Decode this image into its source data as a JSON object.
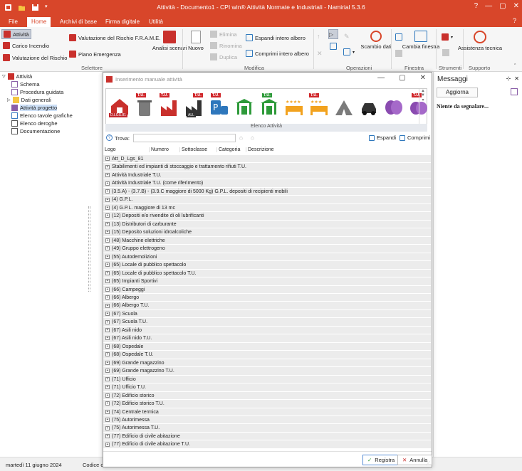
{
  "app": {
    "title": "Attività - Documento1 - CPI win® Attività Normate e Industriali - Namirial 5.3.6",
    "window_controls": [
      "?",
      "—",
      "▢",
      "✕"
    ]
  },
  "ribbon_tabs": [
    "File",
    "Home",
    "Archivi di base",
    "Firma digitale",
    "Utilità"
  ],
  "ribbon": {
    "selettore": {
      "attivita": "Attività",
      "carico_incendio": "Carico Incendio",
      "valutazione_rischio": "Valutazione del Rischio",
      "valutazione_frame": "Valutazione del Rischio F.R.A.M.E.",
      "piano_emergenza": "Piano Emergenza",
      "analisi_scenari": "Analisi scenari",
      "group": "Selettore"
    },
    "modifica": {
      "nuovo": "Nuovo",
      "elimina": "Elimina",
      "rinomina": "Rinomina",
      "duplica": "Duplica",
      "espandi": "Espandi intero albero",
      "comprimi": "Comprimi intero albero",
      "group": "Modifica"
    },
    "operazioni": {
      "scambio_dati": "Scambio dati",
      "group": "Operazioni"
    },
    "finestra": {
      "cambia_finestra": "Cambia finestra",
      "group": "Finestra"
    },
    "strumenti": {
      "group": "Strumenti"
    },
    "supporto": {
      "assistenza": "Assistenza tecnica",
      "group": "Supporto"
    }
  },
  "tree": {
    "root": "Attività",
    "items": [
      "Schema",
      "Procedura guidata",
      "Dati generali",
      "Attività progetto",
      "Elenco tavole grafiche",
      "Elenco deroghe",
      "Documentazione"
    ],
    "selected": "Attività progetto"
  },
  "status": {
    "date": "martedì 11 giugno 2024",
    "codice": "Codice cli"
  },
  "dialog": {
    "title": "Inserimento manuale attività",
    "strip_label": "Elenco Attività",
    "strip_badges": {
      "tu": "T.U.",
      "dlgs": "D.LGS.81",
      "all": "ALL"
    },
    "search_label": "Trova:",
    "search_value": "",
    "expand": "Espandi",
    "collapse": "Comprimi",
    "columns": [
      "Logo",
      "Numero",
      "Sottoclasse",
      "Categoria",
      "Descrizione"
    ],
    "rows": [
      "Att_D_Lgs_81",
      "Stabilimenti ed impianti di stoccaggio e trattamento rifiuti T.U.",
      "Attività Industriale T.U.",
      "Attività Industriale T.U. (come riferimento)",
      "(3.5.A) - (3.7.B) - (3.9.C maggiore di 5000 Kg) G.P.L. depositi di recipienti mobili",
      "(4) G.P.L.",
      "(4) G.P.L. maggiore di 13 mc",
      "(12) Depositi e/o rivendite di oli lubrificanti",
      "(13) Distributori di carburante",
      "(15) Deposito soluzioni idroalcoliche",
      "(48) Macchine elettriche",
      "(49) Gruppo elettrogeno",
      "(55) Autodemolizioni",
      "(65) Locale di pubblico spettacolo",
      "(65) Locale di pubblico spettacolo T.U.",
      "(65) Impianti Sportivi",
      "(66) Campeggi",
      "(66) Albergo",
      "(66) Albergo T.U.",
      "(67) Scuola",
      "(67) Scuola T.U.",
      "(67) Asili nido",
      "(67) Asili nido T.U.",
      "(68) Ospedale",
      "(68) Ospedale T.U.",
      "(69) Grande magazzino",
      "(69) Grande magazzino T.U.",
      "(71) Ufficio",
      "(71) Ufficio T.U.",
      "(72) Edificio storico",
      "(72) Edificio storico T.U.",
      "(74) Centrale termica",
      "(75) Autorimessa",
      "(75) Autorimessa T.U.",
      "(77) Edificio di civile abitazione",
      "(77) Edificio di civile abitazione T.U."
    ],
    "ok": "Registra",
    "cancel": "Annulla"
  },
  "messages": {
    "title": "Messaggi",
    "refresh": "Aggiorna",
    "text": "Niente da segnalare..."
  },
  "colors": {
    "accent": "#d8462a",
    "icon_red": "#c9302c",
    "icon_green": "#2e9a3a",
    "icon_orange": "#f2a21e",
    "icon_purple": "#8a4bb0",
    "icon_grey": "#7b7b7b"
  }
}
